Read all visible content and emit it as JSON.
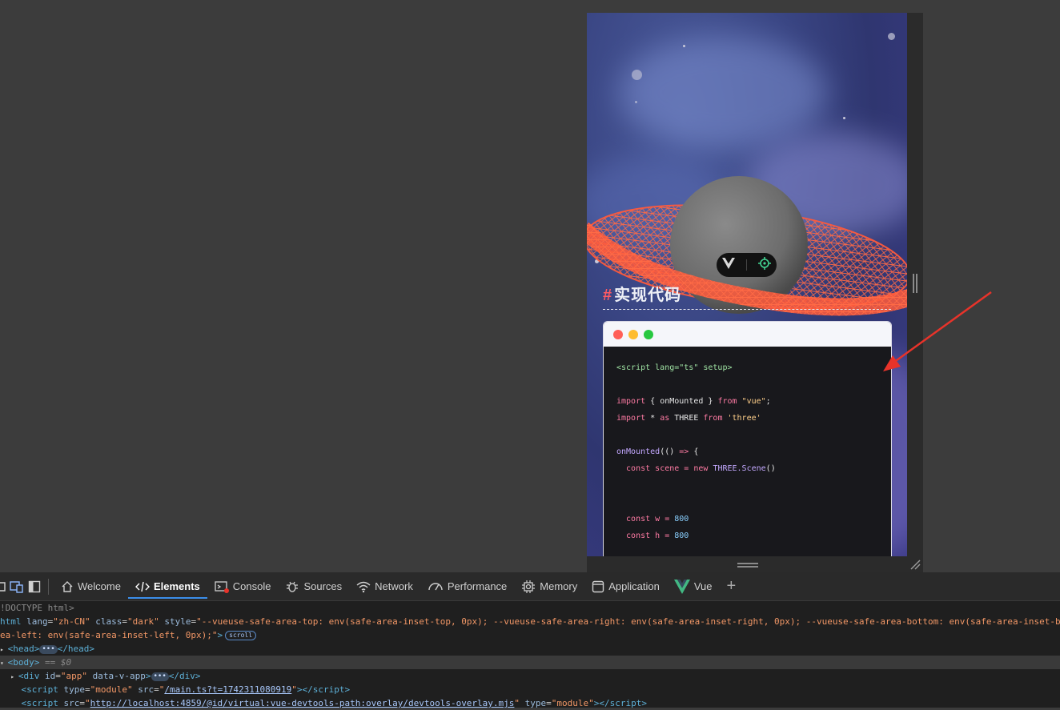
{
  "preview": {
    "heading_hash": "#",
    "heading_text": "实现代码",
    "window_dots": [
      "#ff5f57",
      "#febc2e",
      "#28c840"
    ],
    "code_lines": [
      {
        "parts": [
          {
            "t": "<script lang=\"ts\" setup>",
            "c": "tag"
          }
        ]
      },
      {
        "parts": []
      },
      {
        "parts": [
          {
            "t": "import ",
            "c": "kw"
          },
          {
            "t": "{ onMounted } ",
            "c": ""
          },
          {
            "t": "from ",
            "c": "kw"
          },
          {
            "t": "\"vue\"",
            "c": "str"
          },
          {
            "t": ";",
            "c": ""
          }
        ]
      },
      {
        "parts": [
          {
            "t": "import ",
            "c": "kw"
          },
          {
            "t": "* ",
            "c": ""
          },
          {
            "t": "as ",
            "c": "kw"
          },
          {
            "t": "THREE ",
            "c": ""
          },
          {
            "t": "from ",
            "c": "kw"
          },
          {
            "t": "'three'",
            "c": "str"
          }
        ]
      },
      {
        "parts": []
      },
      {
        "parts": [
          {
            "t": "onMounted",
            "c": "fn"
          },
          {
            "t": "(() ",
            "c": ""
          },
          {
            "t": "=> ",
            "c": "kw"
          },
          {
            "t": "{",
            "c": ""
          }
        ]
      },
      {
        "parts": [
          {
            "t": "  const ",
            "c": "kw"
          },
          {
            "t": "scene ",
            "c": "kw"
          },
          {
            "t": "= ",
            "c": "kw"
          },
          {
            "t": "new ",
            "c": "kw"
          },
          {
            "t": "THREE.Scene",
            "c": "ty"
          },
          {
            "t": "()",
            "c": ""
          }
        ]
      },
      {
        "parts": []
      },
      {
        "parts": []
      },
      {
        "parts": [
          {
            "t": "  const ",
            "c": "kw"
          },
          {
            "t": "w ",
            "c": "kw"
          },
          {
            "t": "= ",
            "c": "kw"
          },
          {
            "t": "800",
            "c": "num"
          }
        ]
      },
      {
        "parts": [
          {
            "t": "  const ",
            "c": "kw"
          },
          {
            "t": "h ",
            "c": "kw"
          },
          {
            "t": "= ",
            "c": "kw"
          },
          {
            "t": "800",
            "c": "num"
          }
        ]
      }
    ]
  },
  "devtools": {
    "tabs": [
      {
        "label": "Welcome",
        "icon": "home-icon",
        "active": false
      },
      {
        "label": "Elements",
        "icon": "code-icon",
        "active": true
      },
      {
        "label": "Console",
        "icon": "console-icon",
        "active": false
      },
      {
        "label": "Sources",
        "icon": "bug-icon",
        "active": false
      },
      {
        "label": "Network",
        "icon": "wifi-icon",
        "active": false
      },
      {
        "label": "Performance",
        "icon": "gauge-icon",
        "active": false
      },
      {
        "label": "Memory",
        "icon": "chip-icon",
        "active": false
      },
      {
        "label": "Application",
        "icon": "window-icon",
        "active": false
      },
      {
        "label": "Vue",
        "icon": "vue-icon",
        "active": false
      }
    ],
    "add_tab_label": "+",
    "dom": {
      "doctype": "!DOCTYPE html>",
      "html_open_tag": "html",
      "html_lang_attr": "lang",
      "html_lang_val": "\"zh-CN\"",
      "html_class_attr": "class",
      "html_class_val": "\"dark\"",
      "html_style_attr": "style",
      "html_style_val_1": "\"--vueuse-safe-area-top: env(safe-area-inset-top, 0px); --vueuse-safe-area-right: env(safe-area-inset-right, 0px); --vueuse-safe-area-bottom: env(safe-area-inset-bo",
      "html_style_val_2": "ea-left: env(safe-area-inset-left, 0px);\"",
      "scroll_badge": "scroll",
      "head_open": "<head>",
      "head_close": "</head>",
      "body_open": "<body>",
      "body_marker": "== $0",
      "div_attrs_id": "id",
      "div_attrs_id_val": "\"app\"",
      "div_attr_vapp": "data-v-app",
      "div_close": "</div>",
      "script1_type_attr": "type",
      "script1_type_val": "\"module\"",
      "script1_src_attr": "src",
      "script1_src": "/main.ts?t=1742311080919",
      "script2_src_attr": "src",
      "script2_src": "http://localhost:4859/@id/virtual:vue-devtools-path:overlay/devtools-overlay.mjs",
      "script2_type_attr": "type",
      "script2_type_val": "\"module\"",
      "ellipsis": "•••"
    }
  },
  "colors": {
    "accent_blue": "#3b8eea",
    "ring": "#ff5a3c",
    "arrow": "#e8332a"
  }
}
